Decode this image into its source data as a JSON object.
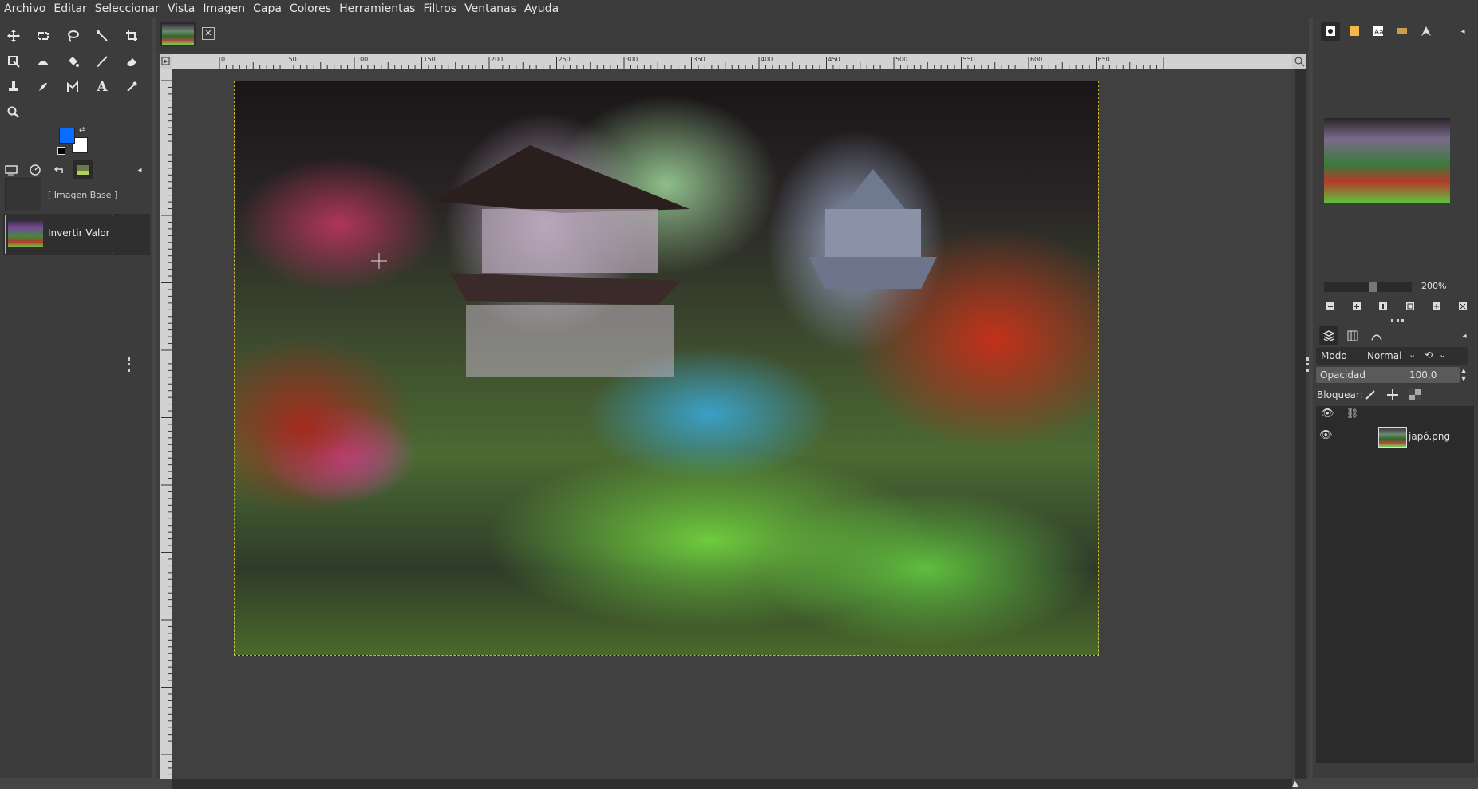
{
  "menubar": {
    "items": [
      "Archivo",
      "Editar",
      "Seleccionar",
      "Vista",
      "Imagen",
      "Capa",
      "Colores",
      "Herramientas",
      "Filtros",
      "Ventanas",
      "Ayuda"
    ]
  },
  "toolbox": {
    "tools": [
      "move",
      "rect-select",
      "lasso",
      "fuzzy-select",
      "crop",
      "unified-transform",
      "warp",
      "bucket-fill",
      "paintbrush",
      "eraser",
      "clone",
      "smudge",
      "paths",
      "text",
      "color-picker",
      "zoom"
    ],
    "text_tool_glyph": "A",
    "fg_color": "#0a6cff",
    "bg_color": "#ffffff"
  },
  "history": {
    "items": [
      {
        "label": "[ Imagen Base ]",
        "selected": false
      },
      {
        "label": "Invertir Valor",
        "selected": true
      }
    ]
  },
  "ruler": {
    "labels": [
      "0",
      "50",
      "100",
      "150",
      "200",
      "250",
      "300",
      "350",
      "400",
      "450",
      "500",
      "550",
      "600",
      "650"
    ]
  },
  "navigator": {
    "zoom": "200%"
  },
  "layers": {
    "mode_label": "Modo",
    "mode_value": "Normal",
    "opacity_label": "Opacidad",
    "opacity_value": "100,0",
    "lock_label": "Bloquear:",
    "items": [
      {
        "name": "japó.png",
        "visible": true
      }
    ]
  },
  "colors": {
    "accent": "#0a6cff",
    "selected_border": "#e6a48c"
  }
}
